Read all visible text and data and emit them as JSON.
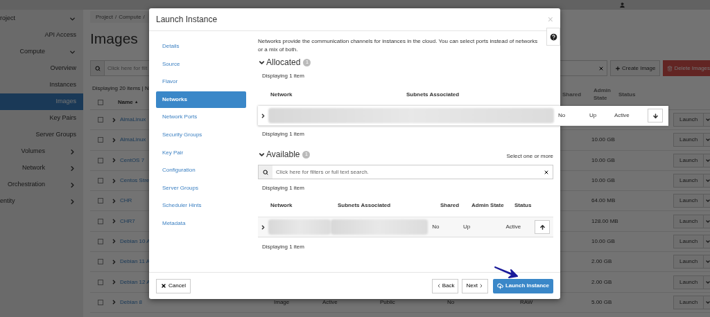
{
  "sidebar": {
    "items": [
      {
        "label": "roject",
        "kind": "root-group",
        "expanded": true
      },
      {
        "label": "API Access",
        "kind": "link",
        "selected": false
      },
      {
        "label": "Compute",
        "kind": "group",
        "expanded": true
      },
      {
        "label": "Overview",
        "kind": "link",
        "selected": false
      },
      {
        "label": "Instances",
        "kind": "link",
        "selected": false
      },
      {
        "label": "Images",
        "kind": "link",
        "selected": true
      },
      {
        "label": "Key Pairs",
        "kind": "link",
        "selected": false
      },
      {
        "label": "Server Groups",
        "kind": "link",
        "selected": false
      },
      {
        "label": "Volumes",
        "kind": "group",
        "expanded": false
      },
      {
        "label": "Network",
        "kind": "group",
        "expanded": false
      },
      {
        "label": "Orchestration",
        "kind": "group",
        "expanded": false
      },
      {
        "label": "entity",
        "kind": "root-group",
        "expanded": false
      }
    ]
  },
  "page": {
    "breadcrumb": [
      {
        "label": "Project",
        "separator": "/"
      },
      {
        "label": "Compute",
        "separator": "/"
      }
    ],
    "title": "Images",
    "filter": {
      "placeholder": "Click here for filt"
    },
    "buttons": [
      {
        "label": "Create Image",
        "kind": "create"
      },
      {
        "label": "Delete Images",
        "kind": "delete"
      }
    ],
    "table": {
      "displaying": "Displaying 20 items | N",
      "select_all_checked": false,
      "columns": [
        {
          "label": "Name",
          "sort_mark": "▲"
        }
      ],
      "rows": [
        {
          "name": "AlmaLinux",
          "checked": false,
          "action": "Launch"
        },
        {
          "name": "AlmaLinux",
          "checked": false,
          "size": "10.00 GB",
          "action": "Launch"
        },
        {
          "name": "CentOS 7",
          "checked": false,
          "size": "10.00 GB",
          "action": "Launch"
        },
        {
          "name": "Centos Stre",
          "checked": false,
          "size": "10.00 GB",
          "action": "Launch"
        },
        {
          "name": "CHR",
          "checked": false,
          "size": "64.00 MB",
          "action": "Launch"
        },
        {
          "name": "CHR7",
          "checked": false,
          "size": "128.00 MB",
          "action": "Launch"
        },
        {
          "name": "Debian 10 A",
          "checked": false,
          "size": "10.00 GB",
          "action": "Launch"
        },
        {
          "name": "Debian 11 A",
          "checked": false,
          "size": "2.00 GB",
          "action": "Launch"
        },
        {
          "name": "Debian 12 A",
          "checked": false,
          "size": "2.00 GB",
          "action": "Launch"
        },
        {
          "name": "Debian 8",
          "checked": false,
          "type": "Image",
          "status": "Active",
          "visibility": "Public",
          "protected": "No",
          "format": "RAW",
          "size": "5.00 GB",
          "action": "Launch"
        }
      ]
    }
  },
  "modal": {
    "title": "Launch Instance",
    "close": "×",
    "steps": [
      {
        "label": "Details",
        "selected": false
      },
      {
        "label": "Source",
        "selected": false
      },
      {
        "label": "Flavor",
        "selected": false
      },
      {
        "label": "Networks",
        "selected": true
      },
      {
        "label": "Network Ports",
        "selected": false
      },
      {
        "label": "Security Groups",
        "selected": false
      },
      {
        "label": "Key Pair",
        "selected": false
      },
      {
        "label": "Configuration",
        "selected": false
      },
      {
        "label": "Server Groups",
        "selected": false
      },
      {
        "label": "Scheduler Hints",
        "selected": false
      },
      {
        "label": "Metadata",
        "selected": false
      }
    ],
    "description": "Networks provide the communication channels for instances in the cloud. You can select ports instead of networks or a mix of both.",
    "allocated": {
      "title": "Allocated",
      "count": "1",
      "expanded": true,
      "displaying": "Displaying 1 item",
      "columns": [
        "Network",
        "Subnets Associated",
        "Shared",
        "Admin State",
        "Status"
      ],
      "rows": [
        {
          "shared": "No",
          "admin_state": "Up",
          "status": "Active"
        }
      ],
      "footer": "Displaying 1 item"
    },
    "available": {
      "title": "Available",
      "count": "1",
      "expanded": true,
      "hint": "Select one or more",
      "search": {
        "placeholder": "Click here for filters or full text search."
      },
      "displaying": "Displaying 1 item",
      "columns": [
        "Network",
        "Subnets Associated",
        "Shared",
        "Admin State",
        "Status"
      ],
      "rows": [
        {
          "shared": "No",
          "admin_state": "Up",
          "status": "Active"
        }
      ],
      "footer": "Displaying 1 item"
    },
    "buttons": [
      {
        "label": "Cancel",
        "kind": "cancel"
      },
      {
        "label": "Back",
        "kind": "back"
      },
      {
        "label": "Next",
        "kind": "next"
      },
      {
        "label": "Launch Instance",
        "kind": "launch"
      }
    ]
  }
}
